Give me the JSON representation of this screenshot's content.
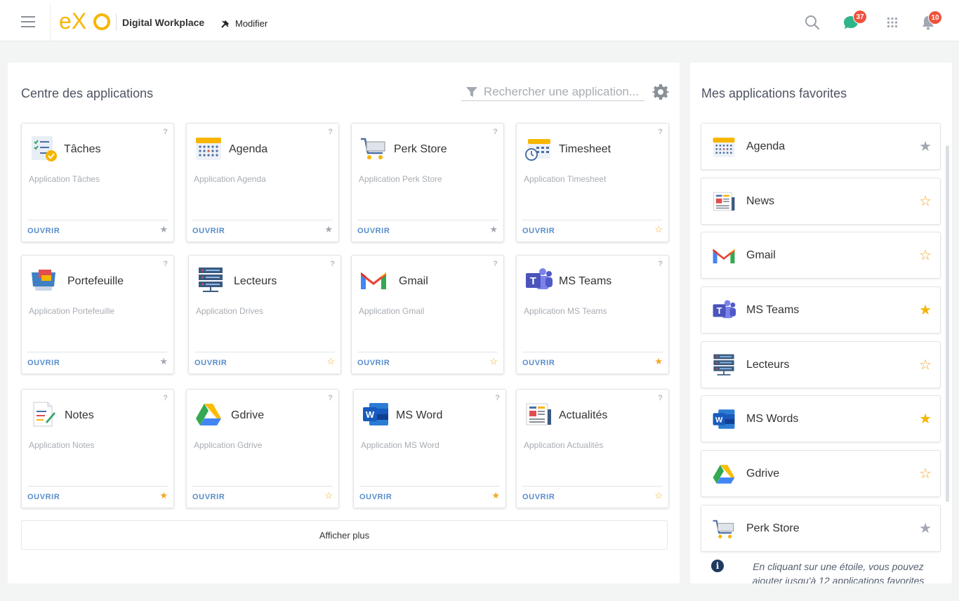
{
  "topbar": {
    "brand": "Digital Workplace",
    "modifier_label": "Modifier",
    "chat_badge": "37",
    "notif_badge": "10"
  },
  "main": {
    "title": "Centre des applications",
    "search_placeholder": "Rechercher une application...",
    "open_label": "OUVRIR",
    "help_label": "?",
    "more_label": "Afficher plus",
    "apps": [
      {
        "name": "Tâches",
        "desc": "Application Tâches",
        "icon": "tasks-icon",
        "star": "grey"
      },
      {
        "name": "Agenda",
        "desc": "Application Agenda",
        "icon": "calendar-icon",
        "star": "grey"
      },
      {
        "name": "Perk Store",
        "desc": "Application Perk Store",
        "icon": "cart-icon",
        "star": "grey"
      },
      {
        "name": "Timesheet",
        "desc": "Application Timesheet",
        "icon": "timesheet-icon",
        "star": "outline"
      },
      {
        "name": "Portefeuille",
        "desc": "Application Portefeuille",
        "icon": "wallet-icon",
        "star": "grey"
      },
      {
        "name": "Lecteurs",
        "desc": "Application Drives",
        "icon": "server-icon",
        "star": "outline"
      },
      {
        "name": "Gmail",
        "desc": "Application Gmail",
        "icon": "gmail-icon",
        "star": "outline"
      },
      {
        "name": "MS Teams",
        "desc": "Application MS Teams",
        "icon": "teams-icon",
        "star": "filled"
      },
      {
        "name": "Notes",
        "desc": "Application Notes",
        "icon": "notes-icon",
        "star": "filled"
      },
      {
        "name": "Gdrive",
        "desc": "Application Gdrive",
        "icon": "gdrive-icon",
        "star": "outline"
      },
      {
        "name": "MS Word",
        "desc": "Application MS Word",
        "icon": "word-icon",
        "star": "filled"
      },
      {
        "name": "Actualités",
        "desc": "Application Actualités",
        "icon": "news-icon",
        "star": "outline"
      }
    ]
  },
  "favorites": {
    "title": "Mes applications favorites",
    "items": [
      {
        "name": "Agenda",
        "icon": "calendar-icon",
        "star": "grey"
      },
      {
        "name": "News",
        "icon": "news-icon",
        "star": "outline"
      },
      {
        "name": "Gmail",
        "icon": "gmail-icon",
        "star": "outline"
      },
      {
        "name": "MS Teams",
        "icon": "teams-icon",
        "star": "filled"
      },
      {
        "name": "Lecteurs",
        "icon": "server-icon",
        "star": "outline"
      },
      {
        "name": "MS Words",
        "icon": "word-icon",
        "star": "filled"
      },
      {
        "name": "Gdrive",
        "icon": "gdrive-icon",
        "star": "outline"
      },
      {
        "name": "Perk Store",
        "icon": "cart-icon",
        "star": "grey"
      }
    ],
    "info_text": "En cliquant sur une étoile, vous pouvez ajouter jusqu'à 12 applications favorites"
  },
  "colors": {
    "accent_blue": "#578dc9",
    "star_gold": "#f5a623",
    "star_grey": "#a2a8b1",
    "badge_red": "#f0513c",
    "exo_yellow": "#f7b500"
  }
}
